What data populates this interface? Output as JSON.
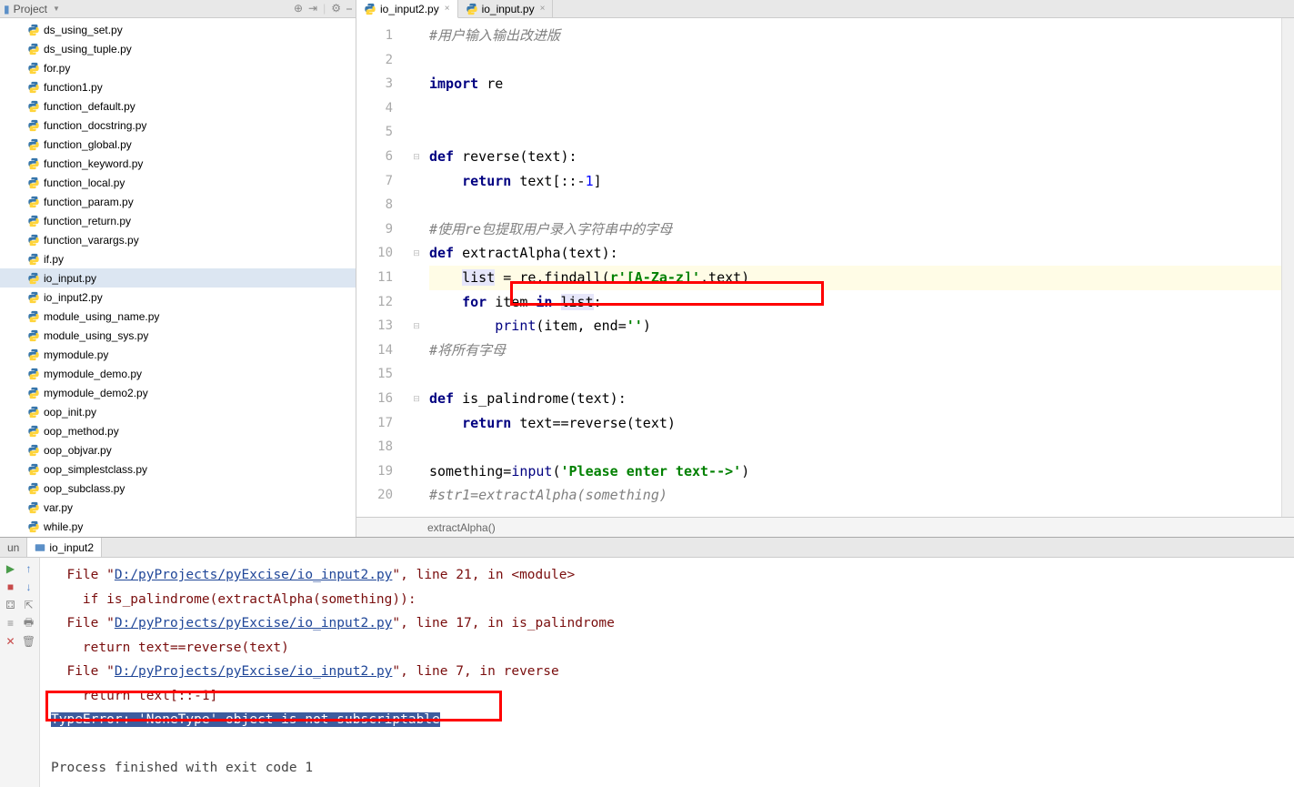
{
  "sidebar": {
    "title": "Project",
    "files": [
      {
        "name": "ds_using_set.py"
      },
      {
        "name": "ds_using_tuple.py"
      },
      {
        "name": "for.py"
      },
      {
        "name": "function1.py"
      },
      {
        "name": "function_default.py"
      },
      {
        "name": "function_docstring.py"
      },
      {
        "name": "function_global.py"
      },
      {
        "name": "function_keyword.py"
      },
      {
        "name": "function_local.py"
      },
      {
        "name": "function_param.py"
      },
      {
        "name": "function_return.py"
      },
      {
        "name": "function_varargs.py"
      },
      {
        "name": "if.py"
      },
      {
        "name": "io_input.py",
        "selected": true
      },
      {
        "name": "io_input2.py"
      },
      {
        "name": "module_using_name.py"
      },
      {
        "name": "module_using_sys.py"
      },
      {
        "name": "mymodule.py"
      },
      {
        "name": "mymodule_demo.py"
      },
      {
        "name": "mymodule_demo2.py"
      },
      {
        "name": "oop_init.py"
      },
      {
        "name": "oop_method.py"
      },
      {
        "name": "oop_objvar.py"
      },
      {
        "name": "oop_simplestclass.py"
      },
      {
        "name": "oop_subclass.py"
      },
      {
        "name": "var.py"
      },
      {
        "name": "while.py"
      }
    ]
  },
  "tabs": [
    {
      "label": "io_input2.py",
      "active": true
    },
    {
      "label": "io_input.py",
      "active": false
    }
  ],
  "code_lines": [
    {
      "n": 1,
      "t": "comment",
      "text": "#用户输入输出改进版"
    },
    {
      "n": 2,
      "text": ""
    },
    {
      "n": 3,
      "html": "<span class='kw'>import</span> re"
    },
    {
      "n": 4,
      "text": ""
    },
    {
      "n": 5,
      "text": ""
    },
    {
      "n": 6,
      "fold": true,
      "html": "<span class='kw'>def</span> reverse(text):"
    },
    {
      "n": 7,
      "html": "    <span class='kw'>return</span> text[::-<span class='num'>1</span>]"
    },
    {
      "n": 8,
      "text": ""
    },
    {
      "n": 9,
      "t": "comment",
      "text": "#使用re包提取用户录入字符串中的字母"
    },
    {
      "n": 10,
      "fold": true,
      "html": "<span class='kw'>def</span> extractAlpha(text):"
    },
    {
      "n": 11,
      "hl": true,
      "html": "    <span style='background:#e6e6fa;'>list</span> = re.findall(<span class='str'>r'[A-Za-z]'</span>,text)"
    },
    {
      "n": 12,
      "html": "    <span class='kw'>for</span> item <span class='kw'>in</span> <span style='background:#e6e6fa;'>list</span>:"
    },
    {
      "n": 13,
      "fold": true,
      "html": "        <span class='builtin'>print</span>(item, end=<span class='str'>''</span>)"
    },
    {
      "n": 14,
      "t": "comment",
      "text": "#将所有字母"
    },
    {
      "n": 15,
      "text": ""
    },
    {
      "n": 16,
      "fold": true,
      "html": "<span class='kw'>def</span> is_palindrome(text):"
    },
    {
      "n": 17,
      "html": "    <span class='kw'>return</span> text==reverse(text)"
    },
    {
      "n": 18,
      "text": ""
    },
    {
      "n": 19,
      "html": "something=<span class='builtin'>input</span>(<span class='str'>'Please enter text--&gt;'</span>)"
    },
    {
      "n": 20,
      "t": "comment",
      "text": "#str1=extractAlpha(something)"
    }
  ],
  "breadcrumb": "extractAlpha()",
  "run": {
    "label": "un",
    "current": "io_input2",
    "console": [
      {
        "type": "trace",
        "indent": 2,
        "prefix": "File \"",
        "link": "D:/pyProjects/pyExcise/io_input2.py",
        "suffix": "\", line 21, in <module>"
      },
      {
        "type": "plain",
        "indent": 4,
        "text": "if is_palindrome(extractAlpha(something)):"
      },
      {
        "type": "trace",
        "indent": 2,
        "prefix": "File \"",
        "link": "D:/pyProjects/pyExcise/io_input2.py",
        "suffix": "\", line 17, in is_palindrome"
      },
      {
        "type": "plain",
        "indent": 4,
        "text": "return text==reverse(text)"
      },
      {
        "type": "trace",
        "indent": 2,
        "prefix": "File \"",
        "link": "D:/pyProjects/pyExcise/io_input2.py",
        "suffix": "\", line 7, in reverse"
      },
      {
        "type": "plain",
        "indent": 4,
        "text": "return text[::-1]"
      },
      {
        "type": "error",
        "text": "TypeError: 'NoneType' object is not subscriptable"
      },
      {
        "type": "blank"
      },
      {
        "type": "exit",
        "text": "Process finished with exit code 1"
      }
    ]
  }
}
